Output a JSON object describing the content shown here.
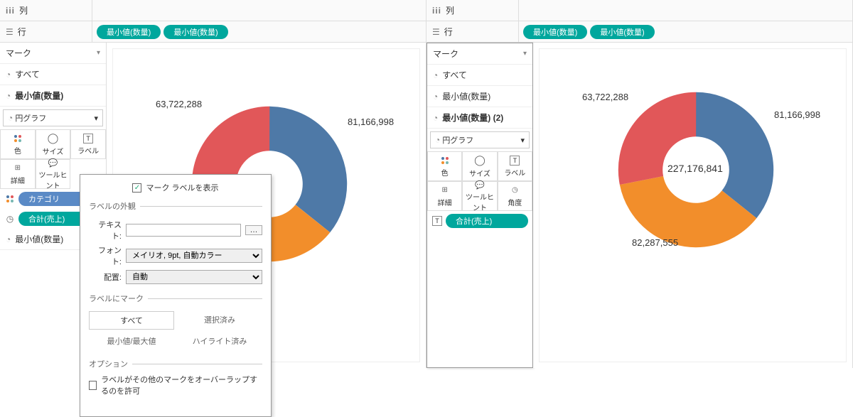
{
  "left": {
    "shelves": {
      "columns_label": "列",
      "rows_label": "行",
      "row_pills": [
        "最小値(数量)",
        "最小値(数量)"
      ]
    },
    "marks": {
      "title": "マーク",
      "all": "すべて",
      "section": "最小値(数量)",
      "type": "円グラフ",
      "cells": {
        "color": "色",
        "size": "サイズ",
        "label": "ラベル",
        "detail": "詳細",
        "tooltip": "ツールヒント"
      },
      "pills": [
        {
          "icon": "color",
          "text": "カテゴリ",
          "class": "pill-cat"
        },
        {
          "icon": "angle",
          "text": "合計(売上)",
          "class": ""
        }
      ],
      "lower": "最小値(数量)"
    },
    "labels": [
      "63,722,288",
      "81,166,998"
    ],
    "popup": {
      "show": "マーク ラベルを表示",
      "appearance": "ラベルの外観",
      "text": "テキスト:",
      "font": "フォント:",
      "font_value": "メイリオ, 9pt, 自動カラー",
      "align": "配置:",
      "align_value": "自動",
      "marks_to_label": "ラベルにマーク",
      "all": "すべて",
      "selected": "選択済み",
      "minmax": "最小値/最大値",
      "highlighted": "ハイライト済み",
      "options": "オプション",
      "overlap": "ラベルがその他のマークをオーバーラップするのを許可"
    }
  },
  "right": {
    "shelves": {
      "columns_label": "列",
      "rows_label": "行",
      "row_pills": [
        "最小値(数量)",
        "最小値(数量)"
      ]
    },
    "marks": {
      "title": "マーク",
      "all": "すべて",
      "s1": "最小値(数量)",
      "section": "最小値(数量) (2)",
      "type": "円グラフ",
      "cells": {
        "color": "色",
        "size": "サイズ",
        "label": "ラベル",
        "detail": "詳細",
        "tooltip": "ツールヒント",
        "angle": "角度"
      },
      "pills": [
        {
          "icon": "text",
          "text": "合計(売上)",
          "class": ""
        }
      ]
    },
    "labels": [
      "63,722,288",
      "81,166,998",
      "82,287,555",
      "227,176,841"
    ]
  },
  "chart_data": [
    {
      "type": "pie",
      "title": "",
      "categories": [
        "Blue",
        "Orange",
        "Red"
      ],
      "values": [
        81166998,
        82287555,
        63722288
      ],
      "series_name": "売上",
      "donut": true,
      "colors": [
        "#4e79a7",
        "#f28e2b",
        "#e15759"
      ],
      "labels_shown": [
        "63,722,288",
        "81,166,998"
      ]
    },
    {
      "type": "pie",
      "title": "",
      "categories": [
        "Blue",
        "Orange",
        "Red"
      ],
      "values": [
        81166998,
        82287555,
        63722288
      ],
      "series_name": "売上",
      "donut": true,
      "center_label": "227,176,841",
      "colors": [
        "#4e79a7",
        "#f28e2b",
        "#e15759"
      ],
      "labels_shown": [
        "63,722,288",
        "81,166,998",
        "82,287,555",
        "227,176,841"
      ]
    }
  ]
}
